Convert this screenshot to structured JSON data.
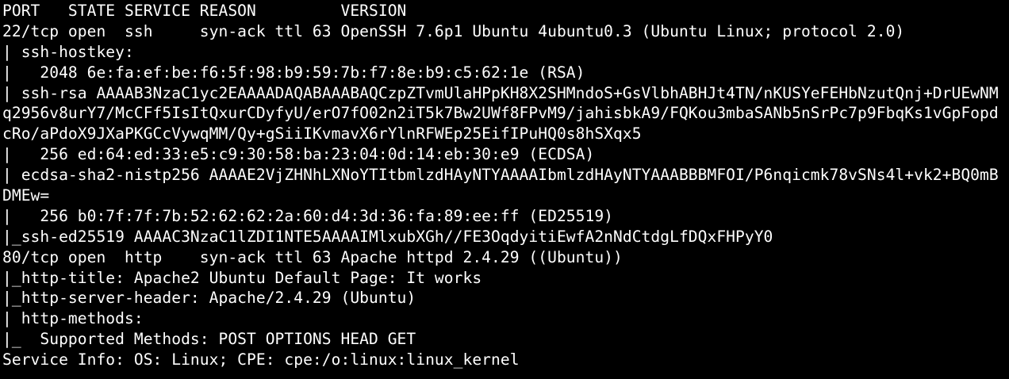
{
  "terminal": {
    "lines": [
      "PORT   STATE SERVICE REASON         VERSION",
      "22/tcp open  ssh     syn-ack ttl 63 OpenSSH 7.6p1 Ubuntu 4ubuntu0.3 (Ubuntu Linux; protocol 2.0)",
      "| ssh-hostkey: ",
      "|   2048 6e:fa:ef:be:f6:5f:98:b9:59:7b:f7:8e:b9:c5:62:1e (RSA)",
      "| ssh-rsa AAAAB3NzaC1yc2EAAAADAQABAAABAQCzpZTvmUlaHPpKH8X2SHMndoS+GsVlbhABHJt4TN/nKUSYeFEHbNzutQnj+DrUEwNM",
      "q2956v8urY7/McCFf5IsItQxurCDyfyU/erO7fO02n2iT5k7Bw2UWf8FPvM9/jahisbkA9/FQKou3mbaSANb5nSrPc7p9FbqKs1vGpFopd",
      "cRo/aPdoX9JXaPKGCcVywqMM/Qy+gSiiIKvmavX6rYlnRFWEp25EifIPuHQ0s8hSXqx5",
      "|   256 ed:64:ed:33:e5:c9:30:58:ba:23:04:0d:14:eb:30:e9 (ECDSA)",
      "| ecdsa-sha2-nistp256 AAAAE2VjZHNhLXNoYTItbmlzdHAyNTYAAAAIbmlzdHAyNTYAAABBBMFOI/P6nqicmk78vSNs4l+vk2+BQ0mB",
      "DMEw=",
      "|   256 b0:7f:7f:7b:52:62:62:2a:60:d4:3d:36:fa:89:ee:ff (ED25519)",
      "|_ssh-ed25519 AAAAC3NzaC1lZDI1NTE5AAAAIMlxubXGh//FE3OqdyitiEwfA2nNdCtdgLfDQxFHPyY0",
      "80/tcp open  http    syn-ack ttl 63 Apache httpd 2.4.29 ((Ubuntu))",
      "|_http-title: Apache2 Ubuntu Default Page: It works",
      "|_http-server-header: Apache/2.4.29 (Ubuntu)",
      "| http-methods: ",
      "|_  Supported Methods: POST OPTIONS HEAD GET",
      "Service Info: OS: Linux; CPE: cpe:/o:linux:linux_kernel"
    ]
  },
  "colors": {
    "background": "#000000",
    "foreground": "#ffffff"
  }
}
